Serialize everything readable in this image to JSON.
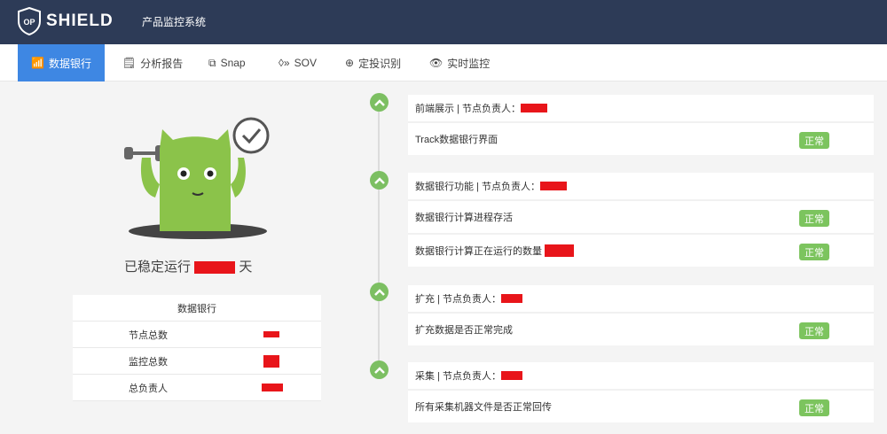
{
  "header": {
    "logo": "SHIELD",
    "logo_badge": "OP",
    "system": "产品监控系统"
  },
  "nav": [
    {
      "label": "数据银行",
      "icon": "chart-dollar-icon"
    },
    {
      "label": "分析报告",
      "icon": "report-icon"
    },
    {
      "label": "Snap",
      "icon": "snap-icon"
    },
    {
      "label": "SOV",
      "icon": "sov-icon"
    },
    {
      "label": "定投识别",
      "icon": "target-icon"
    },
    {
      "label": "实时监控",
      "icon": "eye-icon"
    }
  ],
  "status": {
    "prefix": "已稳定运行",
    "suffix": "天"
  },
  "summary": {
    "title": "数据银行",
    "rows": [
      {
        "label": "节点总数"
      },
      {
        "label": "监控总数"
      },
      {
        "label": "总负责人"
      }
    ]
  },
  "groups": [
    {
      "title": "前端展示 | 节点负责人：",
      "items": [
        {
          "label": "Track数据银行界面",
          "status": "正常"
        }
      ]
    },
    {
      "title": "数据银行功能 | 节点负责人：",
      "items": [
        {
          "label": "数据银行计算进程存活",
          "status": "正常"
        },
        {
          "label": "数据银行计算正在运行的数量",
          "status": "正常"
        }
      ]
    },
    {
      "title": "扩充 | 节点负责人：",
      "items": [
        {
          "label": "扩充数据是否正常完成",
          "status": "正常"
        }
      ]
    },
    {
      "title": "采集 | 节点负责人：",
      "items": [
        {
          "label": "所有采集机器文件是否正常回传",
          "status": "正常"
        }
      ]
    }
  ],
  "colors": {
    "header": "#2d3b57",
    "accent": "#3e87e3",
    "ok": "#7cc45e",
    "redaction": "#e8151a"
  }
}
